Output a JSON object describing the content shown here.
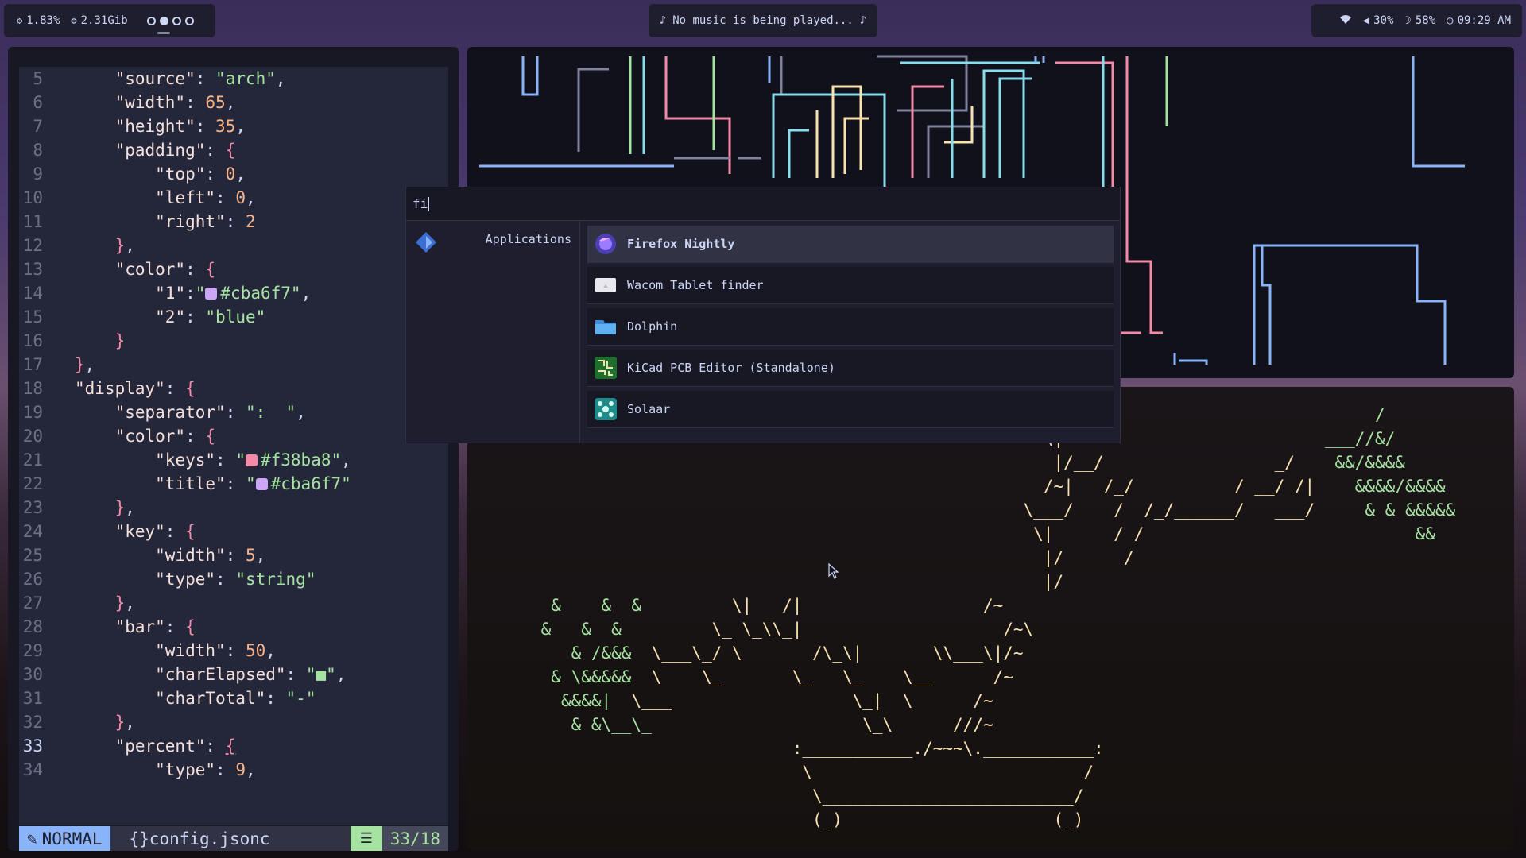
{
  "topbar": {
    "cpu": "1.83%",
    "mem": "2.31Gib",
    "workspaces": [
      false,
      true,
      false,
      false
    ],
    "music": "No music is being played...",
    "volume": "30%",
    "brightness": "58%",
    "time": "09:29 AM",
    "icons": [
      "cpu-icon",
      "memory-icon",
      "music-note-icon",
      "wifi-icon",
      "speaker-icon",
      "moon-icon",
      "clock-icon"
    ]
  },
  "editor": {
    "lines": [
      {
        "n": "5",
        "html": "    <span class='k'>\"source\"</span>: <span class='s'>\"arch\"</span>,"
      },
      {
        "n": "6",
        "html": "    <span class='k'>\"width\"</span>: <span class='n'>65</span>,"
      },
      {
        "n": "7",
        "html": "    <span class='k'>\"height\"</span>: <span class='n'>35</span>,"
      },
      {
        "n": "8",
        "html": "    <span class='k'>\"padding\"</span>: <span class='b'>{</span>"
      },
      {
        "n": "9",
        "html": "        <span class='k'>\"top\"</span>: <span class='n'>0</span>,"
      },
      {
        "n": "10",
        "html": "        <span class='k'>\"left\"</span>: <span class='n'>0</span>,"
      },
      {
        "n": "11",
        "html": "        <span class='k'>\"right\"</span>: <span class='n'>2</span>"
      },
      {
        "n": "12",
        "html": "    <span class='b'>}</span>,"
      },
      {
        "n": "13",
        "html": "    <span class='k'>\"color\"</span>: <span class='b'>{</span>"
      },
      {
        "n": "14",
        "html": "        <span class='k'>\"1\"</span>:<span class='s'>\"<i class='sw' style='background:#cba6f7'></i>#cba6f7\"</span>,"
      },
      {
        "n": "15",
        "html": "        <span class='k'>\"2\"</span>: <span class='s'>\"blue\"</span>"
      },
      {
        "n": "16",
        "html": "    <span class='b'>}</span>"
      },
      {
        "n": "17",
        "html": "<span class='b'>}</span>,"
      },
      {
        "n": "18",
        "html": "<span class='k'>\"display\"</span>: <span class='b'>{</span>"
      },
      {
        "n": "19",
        "html": "    <span class='k'>\"separator\"</span>: <span class='s'>\":  \"</span>,"
      },
      {
        "n": "20",
        "html": "    <span class='k'>\"color\"</span>: <span class='b'>{</span>"
      },
      {
        "n": "21",
        "html": "        <span class='k'>\"keys\"</span>: <span class='s'>\"<i class='sw' style='background:#f38ba8'></i>#f38ba8\"</span>,"
      },
      {
        "n": "22",
        "html": "        <span class='k'>\"title\"</span>: <span class='s'>\"<i class='sw' style='background:#cba6f7'></i>#cba6f7\"</span>"
      },
      {
        "n": "23",
        "html": "    <span class='b'>}</span>,"
      },
      {
        "n": "24",
        "html": "    <span class='k'>\"key\"</span>: <span class='b'>{</span>"
      },
      {
        "n": "25",
        "html": "        <span class='k'>\"width\"</span>: <span class='n'>5</span>,"
      },
      {
        "n": "26",
        "html": "        <span class='k'>\"type\"</span>: <span class='s'>\"string\"</span>"
      },
      {
        "n": "27",
        "html": "    <span class='b'>}</span>,"
      },
      {
        "n": "28",
        "html": "    <span class='k'>\"bar\"</span>: <span class='b'>{</span>"
      },
      {
        "n": "29",
        "html": "        <span class='k'>\"width\"</span>: <span class='n'>50</span>,"
      },
      {
        "n": "30",
        "html": "        <span class='k'>\"charElapsed\"</span>: <span class='s'>\"■\"</span>,"
      },
      {
        "n": "31",
        "html": "        <span class='k'>\"charTotal\"</span>: <span class='s'>\"-\"</span>"
      },
      {
        "n": "32",
        "html": "    <span class='b'>}</span>,"
      },
      {
        "n": "33",
        "html": "    <span class='k'>\"percent\"</span>: <span class='b' style='text-decoration:underline'>{</span>",
        "cur": true
      },
      {
        "n": "34",
        "html": "        <span class='k'>\"type\"</span>: <span class='n'>9</span>,"
      }
    ],
    "status": {
      "mode": "NORMAL",
      "file": "{}config.jsonc",
      "position": "33/18"
    }
  },
  "launcher": {
    "query": "fi",
    "category": "Applications",
    "results": [
      {
        "name": "Firefox Nightly",
        "icon": "firefox-icon",
        "selected": true
      },
      {
        "name": "Wacom Tablet finder",
        "icon": "wacom-icon",
        "selected": false
      },
      {
        "name": "Dolphin",
        "icon": "folder-icon",
        "selected": false
      },
      {
        "name": "KiCad PCB Editor (Standalone)",
        "icon": "kicad-icon",
        "selected": false
      },
      {
        "name": "Solaar",
        "icon": "solaar-icon",
        "selected": false
      }
    ]
  },
  "colors": {
    "accent": "#89b4fa",
    "base": "#1e1e2e",
    "text": "#cdd6f4",
    "green": "#a6e3a1",
    "yellow": "#f9e2af",
    "red": "#f38ba8",
    "mauve": "#cba6f7"
  }
}
